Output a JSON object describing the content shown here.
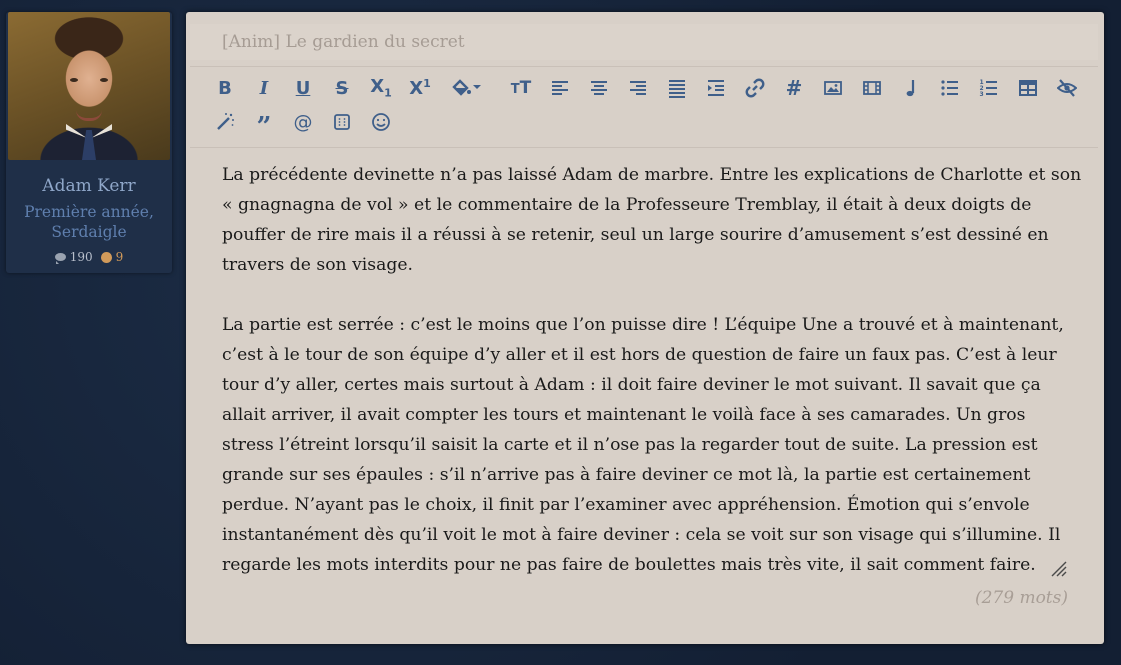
{
  "profile": {
    "name": "Adam Kerr",
    "rank_line1": "Première année,",
    "rank_line2": "Serdaigle",
    "messages": "190",
    "points": "9",
    "colors": {
      "points": "#d19a5a",
      "name": "#8fa7c9",
      "rank": "#5f7fae"
    }
  },
  "editor": {
    "title": "[Anim] Le gardien du secret",
    "toolbar": [
      {
        "id": "bold",
        "icon": "bold-icon"
      },
      {
        "id": "italic",
        "icon": "italic-icon"
      },
      {
        "id": "underline",
        "icon": "underline-icon"
      },
      {
        "id": "strike",
        "icon": "strikethrough-icon"
      },
      {
        "id": "subscript",
        "icon": "subscript-icon"
      },
      {
        "id": "superscript",
        "icon": "superscript-icon"
      },
      {
        "id": "color",
        "icon": "paint-bucket-icon"
      },
      {
        "id": "fontsize",
        "icon": "text-size-icon"
      },
      {
        "id": "align-left",
        "icon": "align-left-icon"
      },
      {
        "id": "align-center",
        "icon": "align-center-icon"
      },
      {
        "id": "align-right",
        "icon": "align-right-icon"
      },
      {
        "id": "justify",
        "icon": "align-justify-icon"
      },
      {
        "id": "indent",
        "icon": "indent-icon"
      },
      {
        "id": "link",
        "icon": "link-icon"
      },
      {
        "id": "hashtag",
        "icon": "hashtag-icon"
      },
      {
        "id": "image",
        "icon": "image-icon"
      },
      {
        "id": "video",
        "icon": "film-icon"
      },
      {
        "id": "music",
        "icon": "music-note-icon"
      },
      {
        "id": "bullet-list",
        "icon": "bullet-list-icon"
      },
      {
        "id": "numbered-list",
        "icon": "numbered-list-icon"
      },
      {
        "id": "table",
        "icon": "table-icon"
      },
      {
        "id": "hide",
        "icon": "eye-slash-icon"
      },
      {
        "id": "magic",
        "icon": "magic-wand-icon"
      },
      {
        "id": "quote",
        "icon": "quote-icon"
      },
      {
        "id": "mention",
        "icon": "at-sign-icon"
      },
      {
        "id": "spoiler",
        "icon": "dotted-box-icon"
      },
      {
        "id": "emoji",
        "icon": "smiley-icon"
      }
    ],
    "paragraphs": [
      "La précédente devinette n’a pas laissé Adam de marbre. Entre les explications de Charlotte et son « gnagnagna de vol » et le commentaire de la Professeure Tremblay, il était à deux doigts de pouffer de rire mais il a réussi à se retenir, seul un large sourire d’amusement s’est dessiné en travers de son visage.",
      "La partie est serrée : c’est le moins que l’on puisse dire ! L’équipe Une a trouvé et à maintenant, c’est à le tour de son équipe d’y aller et il est hors de question de faire un faux pas. C’est à leur tour d’y aller, certes mais surtout à Adam : il doit faire deviner le mot suivant. Il savait que ça allait arriver, il avait compter les tours et maintenant le voilà face à ses camarades. Un gros stress l’étreint lorsqu’il saisit la carte et il n’ose pas la regarder tout de suite. La pression est grande sur ses épaules : s’il n’arrive pas à faire deviner ce mot là, la partie est certainement perdue. N’ayant pas le choix, il finit par l’examiner avec appréhension. Émotion qui s’envole instantanément dès qu’il voit le mot à faire deviner : cela se voit sur son visage qui s’illumine. Il regarde les mots interdits pour ne pas faire de boulettes mais très vite, il sait comment faire."
    ],
    "word_count": "(279 mots)",
    "colors": {
      "icon": "#3f5f8a",
      "panel": "#d8d0c8",
      "placeholder": "#a69c94"
    }
  }
}
